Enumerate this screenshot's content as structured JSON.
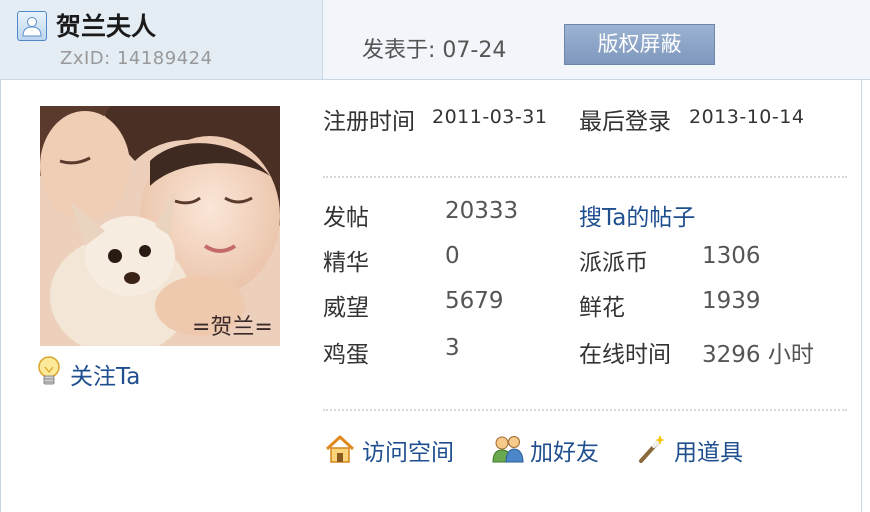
{
  "header": {
    "username": "贺兰夫人",
    "zxid": "ZxID:  14189424",
    "posted_label": "发表于:",
    "posted_date": "07-24",
    "block_button": "版权屏蔽"
  },
  "avatar": {
    "caption": "=贺兰="
  },
  "follow": {
    "label": "关注Ta"
  },
  "registration": {
    "reg_label": "注册时间",
    "reg_date": "2011-03-31",
    "last_label": "最后登录",
    "last_date": "2013-10-14"
  },
  "stats": {
    "posts_label": "发帖",
    "posts_value": "20333",
    "search_link": "搜Ta的帖子",
    "essence_label": "精华",
    "essence_value": "0",
    "coins_label": "派派币",
    "coins_value": "1306",
    "prestige_label": "威望",
    "prestige_value": "5679",
    "flowers_label": "鲜花",
    "flowers_value": "1939",
    "eggs_label": "鸡蛋",
    "eggs_value": "3",
    "online_label": "在线时间",
    "online_value": "3296 小时"
  },
  "actions": {
    "visit_space": "访问空间",
    "add_friend": "加好友",
    "use_item": "用道具"
  },
  "colors": {
    "link": "#1f4f8e",
    "header_bg": "#e4ecf4",
    "button_bg": "#8ca5c8"
  }
}
